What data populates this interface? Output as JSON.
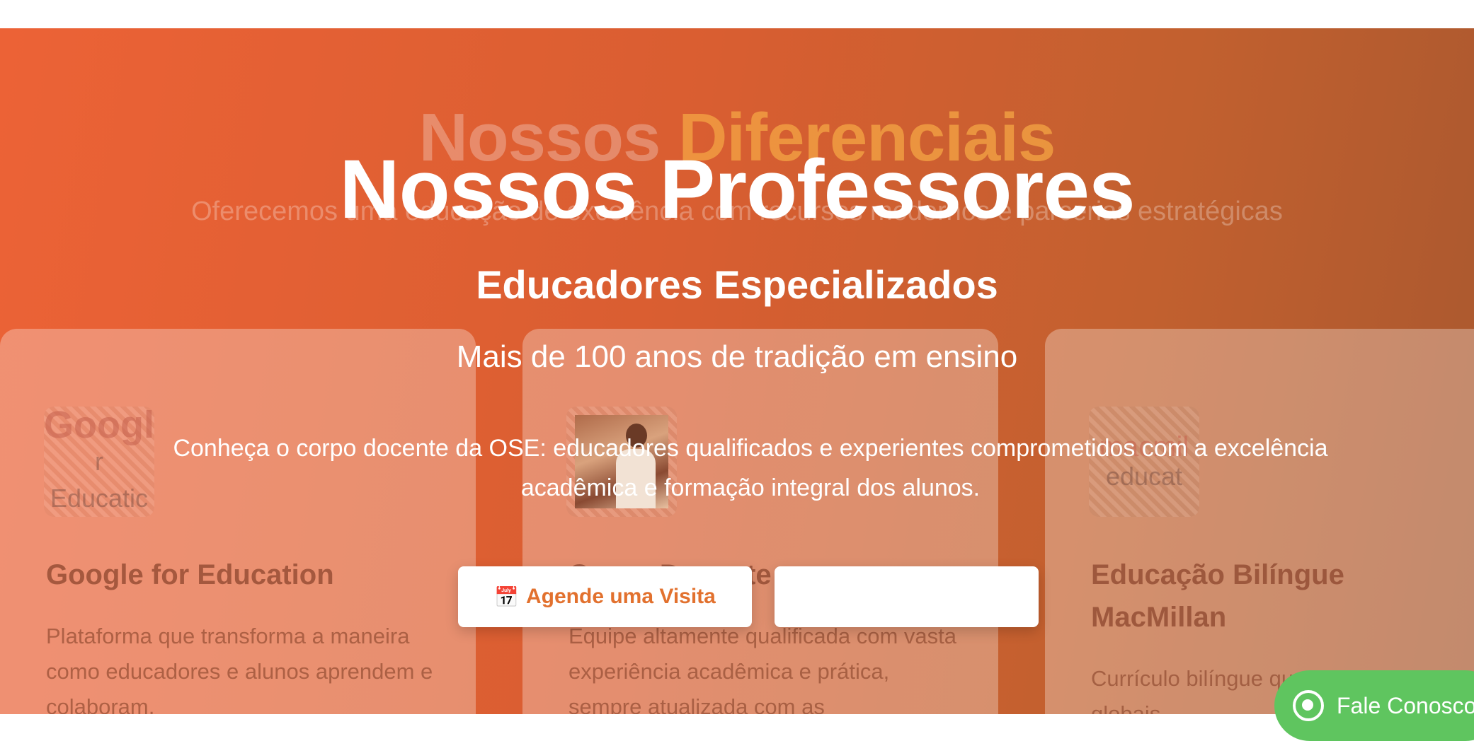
{
  "background": {
    "title_main": "Nossos",
    "title_accent": "Diferenciais",
    "subtitle": "Oferecemos uma educação de excelência com recursos modernos e parcerias estratégicas",
    "cards": [
      {
        "logo_main": "Googl",
        "logo_sub": "r Educatic",
        "title": "Google for Education",
        "text": "Plataforma que transforma a maneira como educadores e alunos aprendem e colaboram,"
      },
      {
        "title": "Corpo Docente",
        "text": "Equipe altamente qualificada com vasta experiência acadêmica e prática, sempre atualizada com as"
      },
      {
        "logo_main": "macmil",
        "logo_sub": "educat",
        "title": "Educação Bilíngue MacMillan",
        "text": "Currículo bilíngue que forma cidadãos globais"
      }
    ]
  },
  "hero": {
    "title": "Nossos Professores",
    "subtitle": "Educadores Especializados",
    "tagline": "Mais de 100 anos de tradição em ensino",
    "description": "Conheça o corpo docente da OSE: educadores qualificados e experientes comprometidos com a excelência acadêmica e formação integral dos alunos.",
    "primary_button": {
      "icon": "📅",
      "label": "Agende uma Visita"
    },
    "secondary_button": {
      "label": ""
    }
  },
  "whatsapp": {
    "label": "Fale Conosco",
    "icon": "whatsapp-icon"
  },
  "colors": {
    "gradient_start": "#ec6236",
    "gradient_end": "#a9582f",
    "button_text": "#e2712e",
    "whatsapp": "#5fc55f",
    "accent_title": "#f4a644"
  }
}
